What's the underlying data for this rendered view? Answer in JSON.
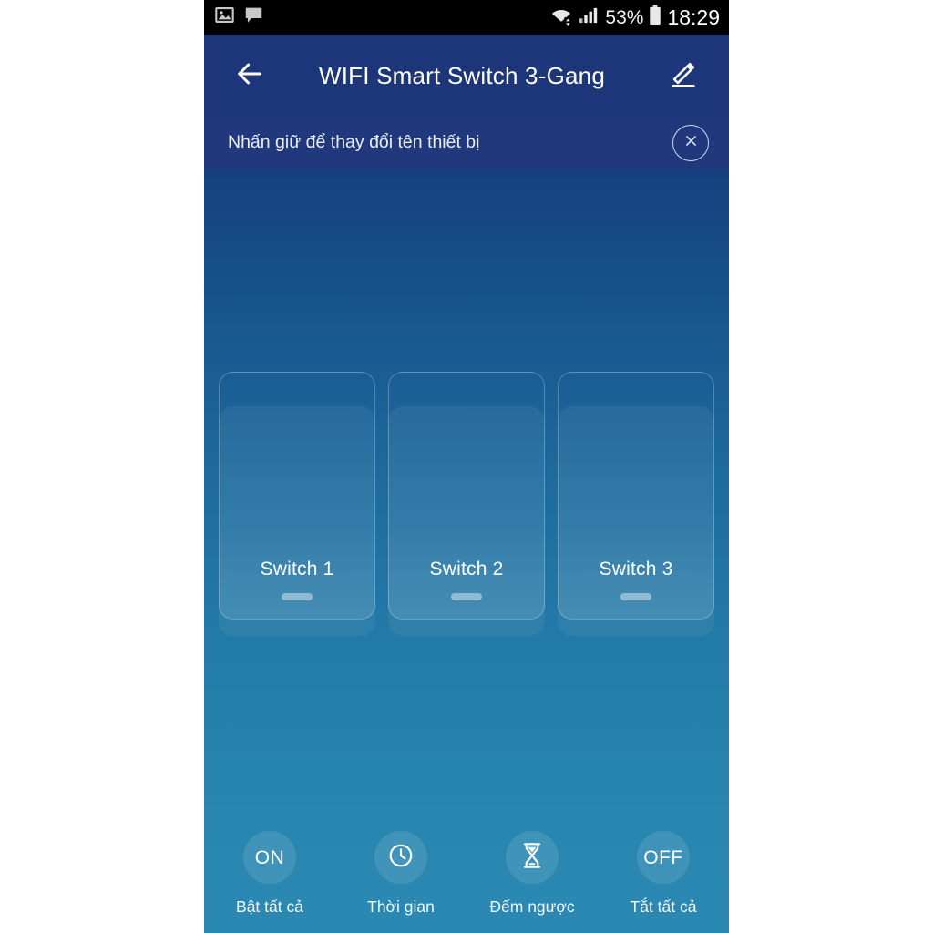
{
  "status_bar": {
    "left_icons": [
      "image-icon",
      "message-icon"
    ],
    "wifi_icon": "wifi-transfer-icon",
    "signal_icon": "cellular-signal-icon",
    "battery_percent": "53%",
    "battery_icon": "battery-icon",
    "time": "18:29"
  },
  "app_bar": {
    "back_icon": "back-arrow-icon",
    "title": "WIFI Smart Switch 3-Gang",
    "edit_icon": "edit-pencil-icon"
  },
  "tip_bar": {
    "text": "Nhấn giữ để thay đổi tên thiết bị",
    "close_icon": "close-circle-icon"
  },
  "switches": [
    {
      "label": "Switch 1",
      "state": "off"
    },
    {
      "label": "Switch 2",
      "state": "off"
    },
    {
      "label": "Switch 3",
      "state": "off"
    }
  ],
  "bottom_actions": [
    {
      "icon": "on-text-icon",
      "icon_text": "ON",
      "label": "Bật tất cả"
    },
    {
      "icon": "clock-icon",
      "icon_text": "",
      "label": "Thời gian"
    },
    {
      "icon": "hourglass-icon",
      "icon_text": "",
      "label": "Đếm ngược"
    },
    {
      "icon": "off-text-icon",
      "icon_text": "OFF",
      "label": "Tắt tất cả"
    }
  ],
  "colors": {
    "status_bar_bg": "#000000",
    "app_bar_bg": "#1c3679",
    "tip_bar_bg": "#21397c",
    "gradient_top": "#15407f",
    "gradient_bottom": "#2a89b2",
    "text_primary": "#ffffff",
    "page_bg": "#ffffff"
  }
}
